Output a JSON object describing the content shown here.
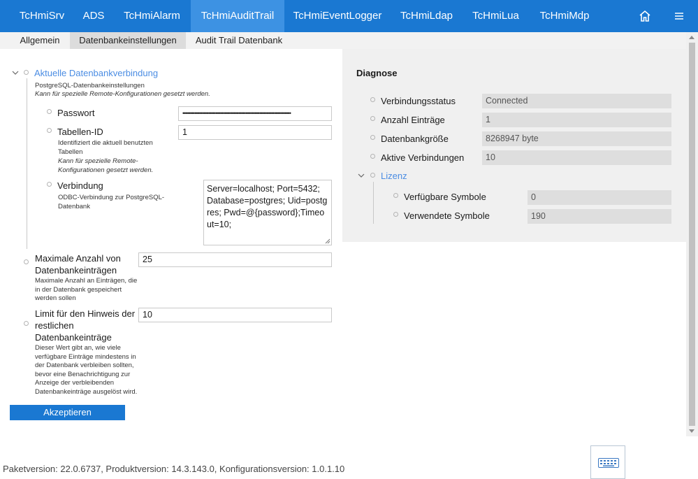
{
  "nav": {
    "items": [
      "TcHmiSrv",
      "ADS",
      "TcHmiAlarm",
      "TcHmiAuditTrail",
      "TcHmiEventLogger",
      "TcHmiLdap",
      "TcHmiLua",
      "TcHmiMdp"
    ],
    "active_index": 3,
    "home_icon": "home-icon",
    "menu_icon": "hamburger-menu-icon"
  },
  "subtabs": {
    "items": [
      "Allgemein",
      "Datenbankeinstellungen",
      "Audit Trail Datenbank"
    ],
    "active_index": 1
  },
  "db": {
    "section_title": "Aktuelle Datenbankverbindung",
    "section_desc": "PostgreSQL-Datenbankeinstellungen",
    "section_desc_italic": "Kann für spezielle Remote-Konfigurationen gesetzt werden.",
    "password_label": "Passwort",
    "password_value": "••••••••••••••••••••••••••••••••••••••••••••••••••••••••••••••••••••••••",
    "table_id_label": "Tabellen-ID",
    "table_id_value": "1",
    "table_id_desc": "Identifiziert die aktuell benutzten Tabellen",
    "table_id_desc_italic": "Kann für spezielle Remote-Konfigurationen gesetzt werden.",
    "connection_label": "Verbindung",
    "connection_desc": "ODBC-Verbindung zur PostgreSQL-Datenbank",
    "connection_value": "Server=localhost; Port=5432; Database=postgres; Uid=postgres; Pwd=@{password};Timeout=10;"
  },
  "max_entries": {
    "label": "Maximale Anzahl von Datenbankeinträgen",
    "desc": "Maximale Anzahl an Einträgen, die in der Datenbank gespeichert werden sollen",
    "value": "25"
  },
  "limit_hint": {
    "label": "Limit für den Hinweis der restlichen Datenbankeinträge",
    "desc": "Dieser Wert gibt an, wie viele verfügbare Einträge mindestens in der Datenbank verbleiben sollten, bevor eine Benachrichtigung zur Anzeige der verbleibenden Datenbankeinträge ausgelöst wird.",
    "value": "10"
  },
  "accept_label": "Akzeptieren",
  "diagnose": {
    "title": "Diagnose",
    "rows": [
      {
        "label": "Verbindungsstatus",
        "value": "Connected"
      },
      {
        "label": "Anzahl Einträge",
        "value": "1"
      },
      {
        "label": "Datenbankgröße",
        "value": "8268947 byte"
      },
      {
        "label": "Aktive Verbindungen",
        "value": "10"
      }
    ],
    "license_title": "Lizenz",
    "license_rows": [
      {
        "label": "Verfügbare Symbole",
        "value": "0"
      },
      {
        "label": "Verwendete Symbole",
        "value": "190"
      }
    ]
  },
  "footer": "Paketversion: 22.0.6737, Produktversion: 14.3.143.0, Konfigurationsversion: 1.0.1.10",
  "keyboard_icon": "keyboard-icon"
}
